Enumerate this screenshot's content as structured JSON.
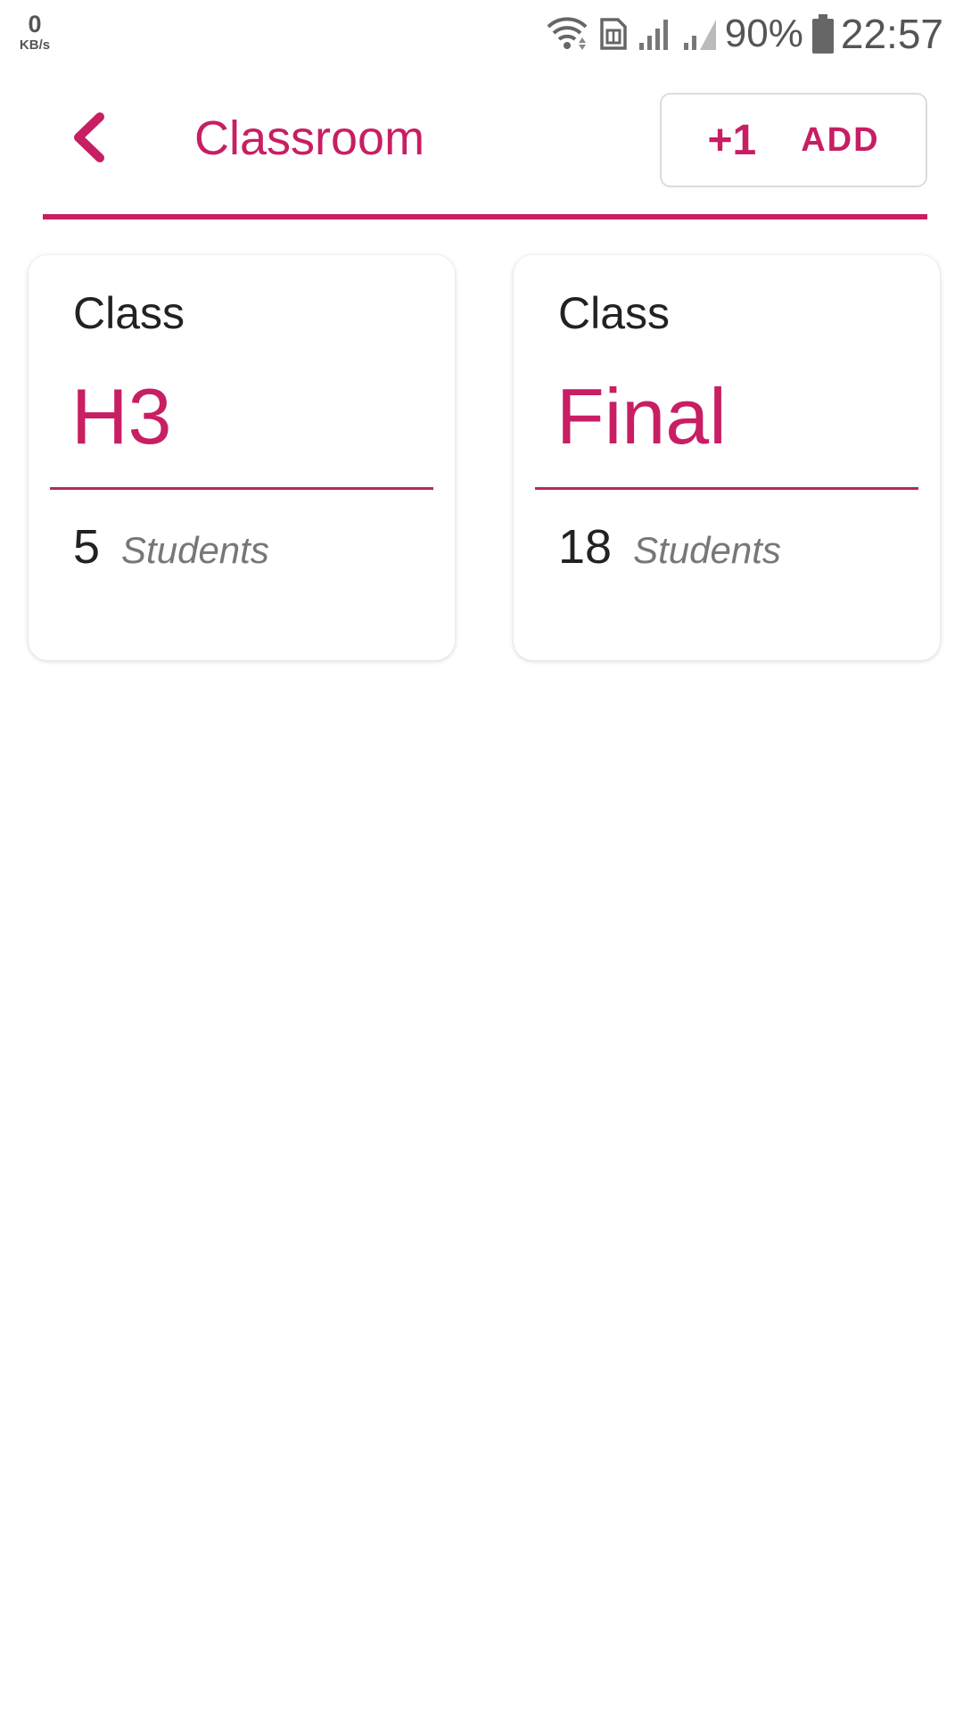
{
  "status_bar": {
    "net_speed_value": "0",
    "net_speed_unit": "KB/s",
    "battery_percent": "90%",
    "time": "22:57",
    "icons": [
      "wifi-icon",
      "sim-card-icon",
      "signal-icon",
      "signal-icon",
      "battery-icon"
    ]
  },
  "header": {
    "title": "Classroom",
    "back_icon": "chevron-left-icon",
    "add_button": {
      "prefix": "+1",
      "label": "ADD"
    }
  },
  "classes": [
    {
      "label": "Class",
      "name": "H3",
      "count": "5",
      "unit": "Students"
    },
    {
      "label": "Class",
      "name": "Final",
      "count": "18",
      "unit": "Students"
    }
  ],
  "colors": {
    "accent": "#c81e63",
    "text_dark": "#222222",
    "text_muted": "#777777"
  }
}
